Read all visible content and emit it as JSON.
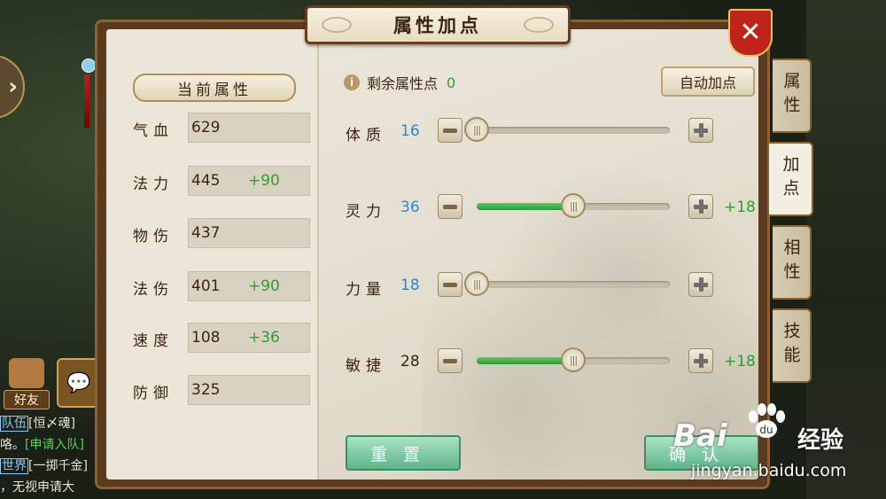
{
  "window": {
    "title": "属性加点",
    "close_label": "✕"
  },
  "left_panel": {
    "section_title": "当前属性",
    "stats": [
      {
        "label": "气血",
        "value": "629",
        "bonus": ""
      },
      {
        "label": "法力",
        "value": "445",
        "bonus": "+90"
      },
      {
        "label": "物伤",
        "value": "437",
        "bonus": ""
      },
      {
        "label": "法伤",
        "value": "401",
        "bonus": "+90"
      },
      {
        "label": "速度",
        "value": "108",
        "bonus": "+36"
      },
      {
        "label": "防御",
        "value": "325",
        "bonus": ""
      }
    ]
  },
  "right_panel": {
    "remaining_label": "剩余属性点",
    "remaining_value": "0",
    "auto_button": "自动加点",
    "attributes": [
      {
        "name": "体质",
        "value": "16",
        "value_color": "blue",
        "slider_level": 0.0,
        "added": ""
      },
      {
        "name": "灵力",
        "value": "36",
        "value_color": "blue",
        "slider_level": 0.5,
        "added": "+18"
      },
      {
        "name": "力量",
        "value": "18",
        "value_color": "blue",
        "slider_level": 0.0,
        "added": ""
      },
      {
        "name": "敏捷",
        "value": "28",
        "value_color": "dark",
        "slider_level": 0.5,
        "added": "+18"
      }
    ],
    "reset_button": "重置",
    "confirm_button": "确认"
  },
  "side_tabs": [
    {
      "label": "属性",
      "active": false
    },
    {
      "label": "加点",
      "active": true
    },
    {
      "label": "相性",
      "active": false
    },
    {
      "label": "技能",
      "active": false
    }
  ],
  "background": {
    "friend_label": "好友",
    "chat_lines": [
      {
        "tag": "队伍",
        "text": "[恒〆魂]"
      },
      {
        "tag": "",
        "text": "咯。",
        "green": "[申请入队]"
      },
      {
        "tag": "世界",
        "text": "[一掷千金]"
      },
      {
        "tag": "",
        "text": "，无视申请大"
      }
    ]
  },
  "watermark": {
    "brand": "Bai",
    "cn": "经验",
    "url": "jingyan.baidu.com"
  },
  "colors": {
    "bonus_green": "#2f9e2f",
    "value_blue": "#2e86d8",
    "slider_fill": "#3cae44"
  }
}
